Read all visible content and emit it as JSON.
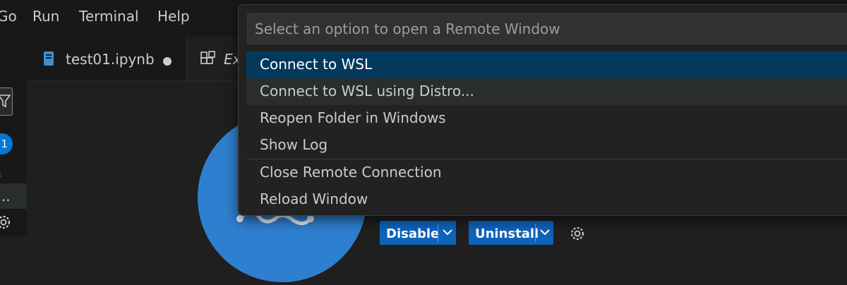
{
  "menubar": {
    "items": [
      "Go",
      "Run",
      "Terminal",
      "Help"
    ]
  },
  "activity": {
    "badge": "1",
    "label_partial": "ns",
    "selected_partial": "l..."
  },
  "tabs": [
    {
      "label": "test01.ipynb",
      "icon": "notebook-icon",
      "dirty": true
    },
    {
      "label": "Ex",
      "icon": "extensions-icon",
      "italic": true
    }
  ],
  "extension": {
    "disable_label": "Disable",
    "uninstall_label": "Uninstall"
  },
  "quickpick": {
    "placeholder": "Select an option to open a Remote Window",
    "items": [
      {
        "label": "Connect to WSL",
        "state": "active"
      },
      {
        "label": "Connect to WSL using Distro...",
        "state": "hover"
      },
      {
        "label": "Reopen Folder in Windows",
        "state": "normal"
      },
      {
        "label": "Show Log",
        "state": "normal"
      },
      {
        "label": "Close Remote Connection",
        "state": "normal",
        "separator_above": true
      },
      {
        "label": "Reload Window",
        "state": "normal"
      }
    ]
  },
  "colors": {
    "accent": "#0078d4",
    "selection": "#04395e",
    "button": "#0e63bb",
    "background": "#1f1f1f"
  }
}
